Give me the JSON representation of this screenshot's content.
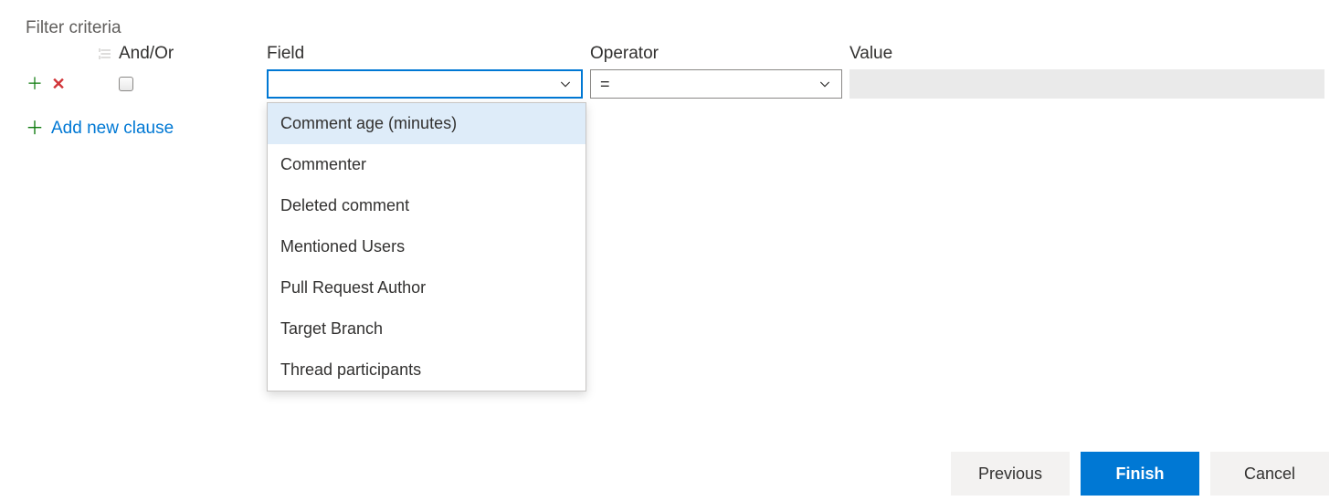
{
  "title": "Filter criteria",
  "headers": {
    "andor": "And/Or",
    "field": "Field",
    "operator": "Operator",
    "value": "Value"
  },
  "row": {
    "andor_checked": false,
    "field_value": "",
    "operator_value": "=",
    "value_value": ""
  },
  "field_dropdown": {
    "options": [
      "Comment age (minutes)",
      "Commenter",
      "Deleted comment",
      "Mentioned Users",
      "Pull Request Author",
      "Target Branch",
      "Thread participants"
    ],
    "highlighted_index": 0
  },
  "add_clause_label": "Add new clause",
  "buttons": {
    "previous": "Previous",
    "finish": "Finish",
    "cancel": "Cancel"
  },
  "icons": {
    "add": "add-icon",
    "delete": "delete-icon",
    "grip": "grip-icon",
    "chevron_down": "chevron-down-icon"
  }
}
